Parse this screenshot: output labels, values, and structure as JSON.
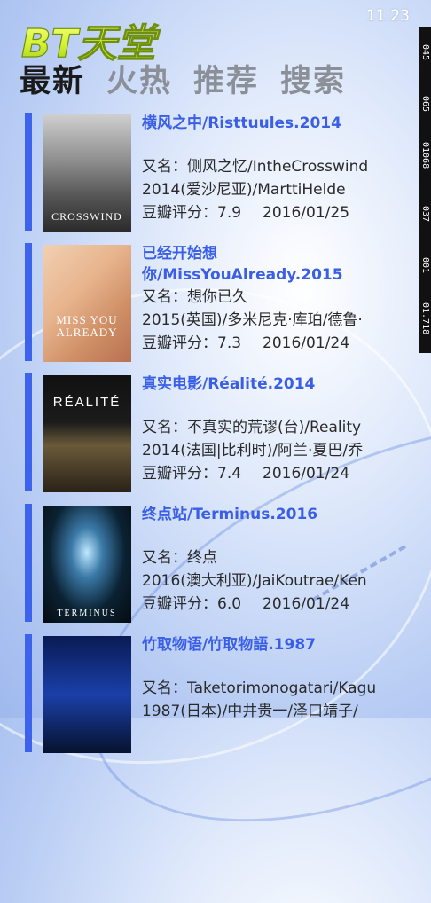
{
  "status": {
    "time": "11:23"
  },
  "app": {
    "logo_text": "BT天堂"
  },
  "tabs": [
    {
      "label": "最新",
      "active": true
    },
    {
      "label": "火热",
      "active": false
    },
    {
      "label": "推荐",
      "active": false
    },
    {
      "label": "搜索",
      "active": false
    }
  ],
  "side_strip": [
    "045",
    "065",
    "01068",
    "037",
    "001",
    "01.718"
  ],
  "movies": [
    {
      "title": "横风之中/Risttuules.2014",
      "alias": "又名：侧风之忆/IntheCrosswind",
      "meta": "2014(爱沙尼亚)/MarttiHelde",
      "rating_label": "豆瓣评分：7.9",
      "date": "2016/01/25",
      "poster_text": "CROSSWIND"
    },
    {
      "title": "已经开始想你/MissYouAlready.2015",
      "alias": "又名：想你已久",
      "meta": "2015(英国)/多米尼克·库珀/德鲁·",
      "rating_label": "豆瓣评分：7.3",
      "date": "2016/01/24",
      "poster_text": "MISS YOU ALREADY"
    },
    {
      "title": "真实电影/Réalité.2014",
      "alias": "又名：不真实的荒谬(台)/Reality",
      "meta": "2014(法国|比利时)/阿兰·夏巴/乔",
      "rating_label": "豆瓣评分：7.4",
      "date": "2016/01/24",
      "poster_text": "RÉALITÉ"
    },
    {
      "title": "终点站/Terminus.2016",
      "alias": "又名：终点",
      "meta": "2016(澳大利亚)/JaiKoutrae/Ken",
      "rating_label": "豆瓣评分：6.0",
      "date": "2016/01/24",
      "poster_text": "TERMINUS"
    },
    {
      "title": "竹取物语/竹取物語.1987",
      "alias": "又名：Taketorimonogatari/Kagu",
      "meta": "1987(日本)/中井贵一/泽口靖子/",
      "rating_label": "",
      "date": "",
      "poster_text": ""
    }
  ],
  "colors": {
    "accent": "#3d63ec",
    "title": "#3a5fe6",
    "tab_active": "#1a1a1a",
    "tab_inactive": "#8a8f98"
  }
}
